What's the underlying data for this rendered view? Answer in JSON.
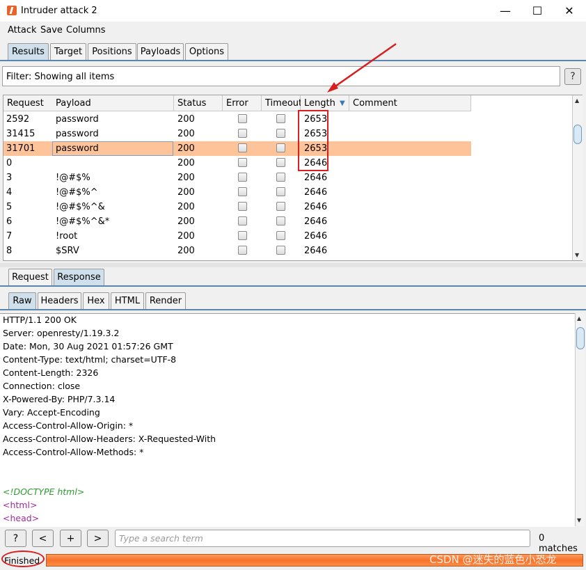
{
  "window": {
    "title": "Intruder attack 2",
    "controls": [
      "—",
      "☐",
      "✕"
    ]
  },
  "menu": [
    "Attack",
    "Save",
    "Columns"
  ],
  "main_tabs": [
    {
      "label": "Results",
      "active": true
    },
    {
      "label": "Target",
      "active": false
    },
    {
      "label": "Positions",
      "active": false
    },
    {
      "label": "Payloads",
      "active": false
    },
    {
      "label": "Options",
      "active": false
    }
  ],
  "filter": {
    "text": "Filter: Showing all items",
    "help": "?"
  },
  "table": {
    "columns": [
      "Request",
      "Payload",
      "Status",
      "Error",
      "Timeout",
      "Length",
      "Comment"
    ],
    "sort_indicator": "▼",
    "sorted_column": "Length",
    "rows": [
      {
        "request": "2592",
        "payload": "password",
        "status": "200",
        "length": "2653",
        "selected": false
      },
      {
        "request": "31415",
        "payload": "password",
        "status": "200",
        "length": "2653",
        "selected": false
      },
      {
        "request": "31701",
        "payload": "password",
        "status": "200",
        "length": "2653",
        "selected": true
      },
      {
        "request": "0",
        "payload": "",
        "status": "200",
        "length": "2646",
        "selected": false
      },
      {
        "request": "3",
        "payload": "!@#$%",
        "status": "200",
        "length": "2646",
        "selected": false
      },
      {
        "request": "4",
        "payload": "!@#$%^",
        "status": "200",
        "length": "2646",
        "selected": false
      },
      {
        "request": "5",
        "payload": "!@#$%^&",
        "status": "200",
        "length": "2646",
        "selected": false
      },
      {
        "request": "6",
        "payload": "!@#$%^&*",
        "status": "200",
        "length": "2646",
        "selected": false
      },
      {
        "request": "7",
        "payload": "!root",
        "status": "200",
        "length": "2646",
        "selected": false
      },
      {
        "request": "8",
        "payload": "$SRV",
        "status": "200",
        "length": "2646",
        "selected": false
      }
    ]
  },
  "message_tabs": [
    {
      "label": "Request",
      "active": false
    },
    {
      "label": "Response",
      "active": true
    }
  ],
  "view_tabs": [
    {
      "label": "Raw",
      "active": true
    },
    {
      "label": "Headers",
      "active": false
    },
    {
      "label": "Hex",
      "active": false
    },
    {
      "label": "HTML",
      "active": false
    },
    {
      "label": "Render",
      "active": false
    }
  ],
  "response_lines": [
    {
      "text": "HTTP/1.1 200 OK",
      "color": "#000000"
    },
    {
      "text": "Server: openresty/1.19.3.2",
      "color": "#000000"
    },
    {
      "text": "Date: Mon, 30 Aug 2021 01:57:26 GMT",
      "color": "#000000"
    },
    {
      "text": "Content-Type: text/html; charset=UTF-8",
      "color": "#000000"
    },
    {
      "text": "Content-Length: 2326",
      "color": "#000000"
    },
    {
      "text": "Connection: close",
      "color": "#000000"
    },
    {
      "text": "X-Powered-By: PHP/7.3.14",
      "color": "#000000"
    },
    {
      "text": "Vary: Accept-Encoding",
      "color": "#000000"
    },
    {
      "text": "Access-Control-Allow-Origin: *",
      "color": "#000000"
    },
    {
      "text": "Access-Control-Allow-Headers: X-Requested-With",
      "color": "#000000"
    },
    {
      "text": "Access-Control-Allow-Methods: *",
      "color": "#000000"
    },
    {
      "text": "",
      "color": "#000000"
    },
    {
      "text": "",
      "color": "#000000"
    },
    {
      "text": "<!DOCTYPE html>",
      "color": "#2e9b2e",
      "italic": true
    },
    {
      "text": "<html>",
      "color": "#9b2d9b"
    },
    {
      "text": "<head>",
      "color": "#9b2d9b"
    }
  ],
  "search": {
    "buttons": [
      "?",
      "<",
      "+",
      ">"
    ],
    "placeholder": "Type a search term",
    "matches": "0 matches"
  },
  "status": {
    "text": "Finished",
    "progress": 1.0
  },
  "watermark": "CSDN @迷失的蓝色小恐龙",
  "colors": {
    "selected_row": "#ffc39a",
    "progress_fill": "#f5722b",
    "annotation": "#d81e1e",
    "active_tab": "#cfe0ec"
  }
}
